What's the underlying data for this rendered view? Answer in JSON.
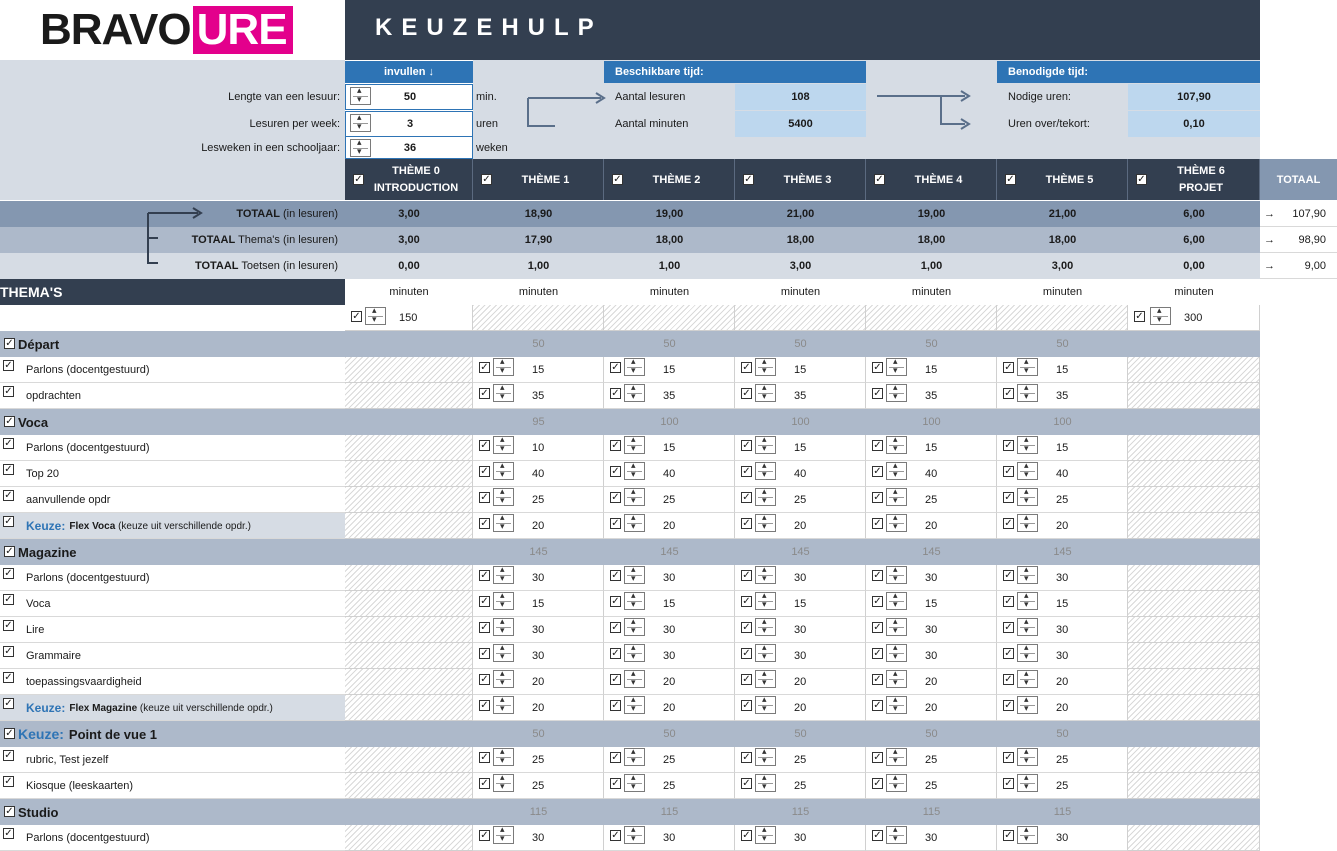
{
  "app": {
    "logo_left": "BRAVO",
    "logo_right": "URE",
    "title": "KEUZEHULP"
  },
  "input": {
    "header": "invullen ↓",
    "rows": [
      {
        "label": "Lengte van een lesuur:",
        "value": "50",
        "unit": "min."
      },
      {
        "label": "Lesuren per week:",
        "value": "3",
        "unit": "uren"
      },
      {
        "label": "Lesweken in een schooljaar:",
        "value": "36",
        "unit": "weken"
      }
    ]
  },
  "available": {
    "header": "Beschikbare tijd:",
    "rows": [
      {
        "label": "Aantal lesuren",
        "value": "108"
      },
      {
        "label": "Aantal minuten",
        "value": "5400"
      }
    ]
  },
  "needed": {
    "header": "Benodigde tijd:",
    "rows": [
      {
        "label": "Nodige uren:",
        "value": "107,90"
      },
      {
        "label": "Uren over/tekort:",
        "value": "0,10"
      }
    ]
  },
  "themes": [
    {
      "line1": "THÈME 0",
      "line2": "INTRODUCTION"
    },
    {
      "line1": "THÈME 1",
      "line2": ""
    },
    {
      "line1": "THÈME 2",
      "line2": ""
    },
    {
      "line1": "THÈME 3",
      "line2": ""
    },
    {
      "line1": "THÈME 4",
      "line2": ""
    },
    {
      "line1": "THÈME 5",
      "line2": ""
    },
    {
      "line1": "THÈME 6",
      "line2": "PROJET"
    }
  ],
  "total_header": "TOTAAL",
  "totals": [
    {
      "label_b": "TOTAAL",
      "label_n": " (in lesuren)",
      "values": [
        "3,00",
        "18,90",
        "19,00",
        "21,00",
        "19,00",
        "21,00",
        "6,00"
      ],
      "total": "107,90"
    },
    {
      "label_b": "TOTAAL",
      "label_n": " Thema's (in lesuren)",
      "values": [
        "3,00",
        "17,90",
        "18,00",
        "18,00",
        "18,00",
        "18,00",
        "6,00"
      ],
      "total": "98,90"
    },
    {
      "label_b": "TOTAAL",
      "label_n": " Toetsen (in lesuren)",
      "values": [
        "0,00",
        "1,00",
        "1,00",
        "3,00",
        "1,00",
        "3,00",
        "0,00"
      ],
      "total": "9,00"
    }
  ],
  "arrow_glyph": "→",
  "themas_title": "THEMA'S",
  "minuten_label": "minuten",
  "theme0_minutes": "150",
  "theme6_minutes": "300",
  "sections": [
    {
      "title": "Départ",
      "keuze": "",
      "sum": [
        "50",
        "50",
        "50",
        "50",
        "50"
      ],
      "items": [
        {
          "label": "Parlons (docentgestuurd)",
          "vals": [
            "15",
            "15",
            "15",
            "15",
            "15"
          ]
        },
        {
          "label": "opdrachten",
          "vals": [
            "35",
            "35",
            "35",
            "35",
            "35"
          ]
        }
      ]
    },
    {
      "title": "Voca",
      "keuze": "",
      "sum": [
        "95",
        "100",
        "100",
        "100",
        "100"
      ],
      "items": [
        {
          "label": "Parlons (docentgestuurd)",
          "vals": [
            "10",
            "15",
            "15",
            "15",
            "15"
          ]
        },
        {
          "label": "Top 20",
          "vals": [
            "40",
            "40",
            "40",
            "40",
            "40"
          ]
        },
        {
          "label": "aanvullende opdr",
          "vals": [
            "25",
            "25",
            "25",
            "25",
            "25"
          ]
        },
        {
          "keuze": "Keuze:",
          "label_b": "Flex Voca",
          "label_n": " (keuze uit verschillende opdr.)",
          "vals": [
            "20",
            "20",
            "20",
            "20",
            "20"
          ]
        }
      ]
    },
    {
      "title": "Magazine",
      "keuze": "",
      "sum": [
        "145",
        "145",
        "145",
        "145",
        "145"
      ],
      "items": [
        {
          "label": "Parlons (docentgestuurd)",
          "vals": [
            "30",
            "30",
            "30",
            "30",
            "30"
          ]
        },
        {
          "label": "Voca",
          "vals": [
            "15",
            "15",
            "15",
            "15",
            "15"
          ]
        },
        {
          "label": "Lire",
          "vals": [
            "30",
            "30",
            "30",
            "30",
            "30"
          ]
        },
        {
          "label": "Grammaire",
          "vals": [
            "30",
            "30",
            "30",
            "30",
            "30"
          ]
        },
        {
          "label": "toepassingsvaardigheid",
          "vals": [
            "20",
            "20",
            "20",
            "20",
            "20"
          ]
        },
        {
          "keuze": "Keuze:",
          "label_b": "Flex Magazine",
          "label_n": " (keuze uit verschillende opdr.)",
          "vals": [
            "20",
            "20",
            "20",
            "20",
            "20"
          ]
        }
      ]
    },
    {
      "title": "Point de vue 1",
      "keuze": "Keuze:",
      "sum": [
        "50",
        "50",
        "50",
        "50",
        "50"
      ],
      "items": [
        {
          "label": "rubric, Test jezelf",
          "vals": [
            "25",
            "25",
            "25",
            "25",
            "25"
          ]
        },
        {
          "label": "Kiosque (leeskaarten)",
          "vals": [
            "25",
            "25",
            "25",
            "25",
            "25"
          ]
        }
      ]
    },
    {
      "title": "Studio",
      "keuze": "",
      "sum": [
        "115",
        "115",
        "115",
        "115",
        "115"
      ],
      "items": [
        {
          "label": "Parlons (docentgestuurd)",
          "vals": [
            "30",
            "30",
            "30",
            "30",
            "30"
          ]
        }
      ]
    }
  ],
  "colors": {
    "dark": "#333f50",
    "blue": "#2e74b5",
    "pink": "#e3008c",
    "band": "#8497b0",
    "lightblue": "#bdd7ee",
    "grey": "#d6dce4"
  }
}
